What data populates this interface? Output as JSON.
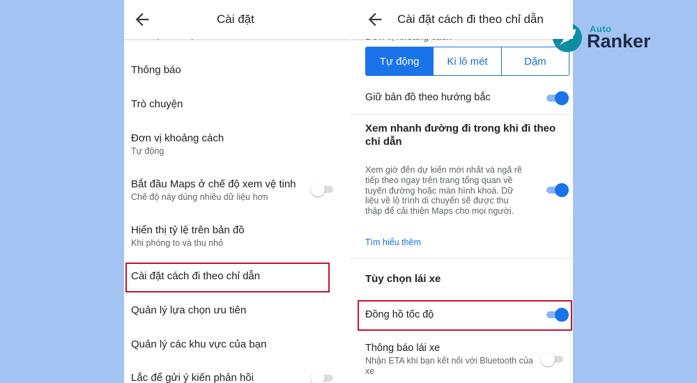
{
  "left_screen": {
    "title": "Cài đặt",
    "clipped_top_item": "Cài đặt xe điện",
    "items": [
      {
        "title": "Thông báo"
      },
      {
        "title": "Trò chuyện"
      },
      {
        "title": "Đơn vị khoảng cách",
        "subtitle": "Tự động"
      },
      {
        "title": "Bắt đầu Maps ở chế độ xem vệ tinh",
        "subtitle": "Chế độ này dùng nhiều dữ liệu hơn",
        "toggle": "off"
      },
      {
        "title": "Hiển thị tỷ lệ trên bản đồ",
        "subtitle": "Khi phóng to và thu nhỏ"
      },
      {
        "title": "Cài đặt cách đi theo chỉ dẫn",
        "highlighted": true
      },
      {
        "title": "Quản lý lựa chọn ưu tiên"
      },
      {
        "title": "Quản lý các khu vực của bạn"
      },
      {
        "title": "Lắc để gửi ý kiến phản hồi",
        "toggle": "off"
      }
    ]
  },
  "right_screen": {
    "title": "Cài đặt cách đi theo chỉ dẫn",
    "clipped_top_item": "Đơn vị khoảng cách",
    "distance_units": {
      "options": [
        "Tự động",
        "Ki lô mét",
        "Dặm"
      ],
      "selected": "Tự động"
    },
    "keep_north_up": {
      "label": "Giữ bản đồ theo hướng bắc",
      "toggle": "on"
    },
    "glanceable": {
      "title": "Xem nhanh đường đi trong khi đi theo chỉ dẫn",
      "description": "Xem giờ đến dự kiến mới nhất và ngã rẽ tiếp theo ngay trên trang tổng quan về tuyến đường hoặc màn hình khoá. Dữ liệu về lộ trình di chuyển sẽ được thu thập để cải thiện Maps cho mọi người.",
      "toggle": "on",
      "learn_more": "Tìm hiểu thêm"
    },
    "driving_section": "Tùy chọn lái xe",
    "speedometer": {
      "label": "Đồng hồ tốc độ",
      "toggle": "on",
      "highlighted": true
    },
    "driving_notifications": {
      "title": "Thông báo lái xe",
      "subtitle": "Nhận ETA khi bạn kết nối với Bluetooth của xe",
      "toggle": "off"
    }
  },
  "watermark": {
    "small": "Auto",
    "big": "Ranker"
  },
  "colors": {
    "background": "#a3c4f3",
    "accent": "#1a73e8",
    "highlight_box": "#c8102e",
    "logo_teal": "#0d8ea3",
    "logo_dark": "#1f2a44"
  }
}
